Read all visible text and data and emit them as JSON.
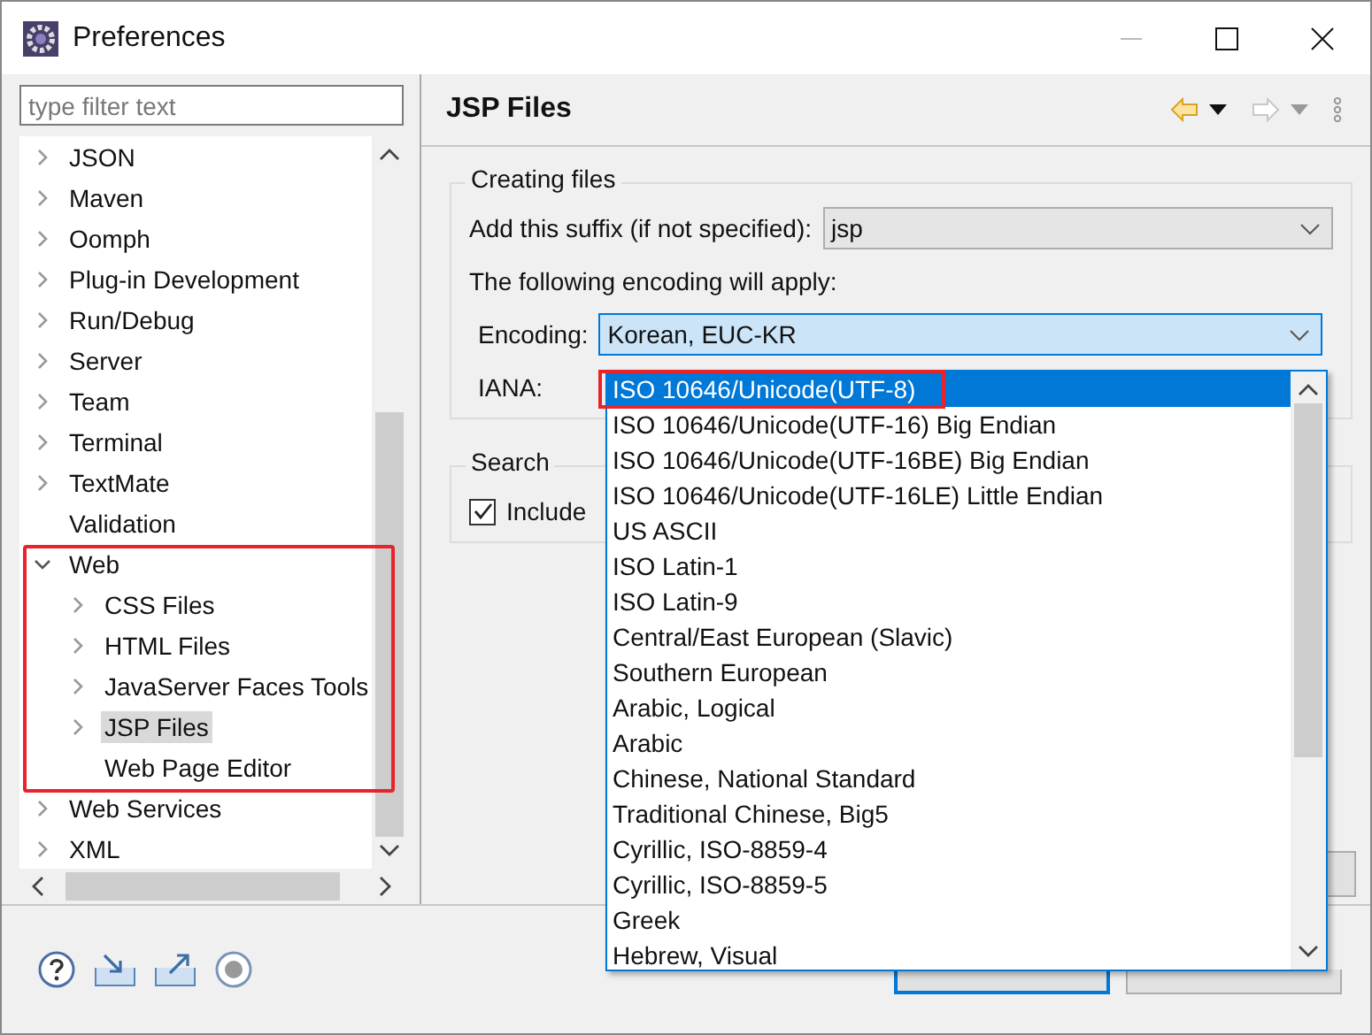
{
  "window": {
    "title": "Preferences"
  },
  "filter": {
    "placeholder": "type filter text"
  },
  "tree": [
    {
      "label": "JSON",
      "expanded": false,
      "selected": false
    },
    {
      "label": "Maven",
      "expanded": false,
      "selected": false
    },
    {
      "label": "Oomph",
      "expanded": false,
      "selected": false
    },
    {
      "label": "Plug-in Development",
      "expanded": false,
      "selected": false
    },
    {
      "label": "Run/Debug",
      "expanded": false,
      "selected": false
    },
    {
      "label": "Server",
      "expanded": false,
      "selected": false
    },
    {
      "label": "Team",
      "expanded": false,
      "selected": false
    },
    {
      "label": "Terminal",
      "expanded": false,
      "selected": false
    },
    {
      "label": "TextMate",
      "expanded": false,
      "selected": false
    },
    {
      "label": "Validation",
      "leaf": true,
      "selected": false
    },
    {
      "label": "Web",
      "expanded": true,
      "selected": false,
      "children": [
        {
          "label": "CSS Files",
          "expanded": false,
          "selected": false
        },
        {
          "label": "HTML Files",
          "expanded": false,
          "selected": false
        },
        {
          "label": "JavaServer Faces Tools",
          "expanded": false,
          "selected": false
        },
        {
          "label": "JSP Files",
          "expanded": false,
          "selected": true
        },
        {
          "label": "Web Page Editor",
          "leaf": true,
          "selected": false
        }
      ]
    },
    {
      "label": "Web Services",
      "expanded": false,
      "selected": false
    },
    {
      "label": "XML",
      "expanded": false,
      "selected": false
    }
  ],
  "page": {
    "title": "JSP Files",
    "creating_group": {
      "title": "Creating files",
      "suffix_label": "Add this suffix (if not specified):",
      "suffix_value": "jsp",
      "encoding_note": "The following encoding will apply:",
      "encoding_label": "Encoding:",
      "encoding_value": "Korean, EUC-KR",
      "iana_label": "IANA:"
    },
    "search_group": {
      "title": "Search",
      "checkbox_label": "Include",
      "checked": true
    }
  },
  "encoding_list": [
    {
      "label": "ISO 10646/Unicode(UTF-8)",
      "selected": true
    },
    {
      "label": "ISO 10646/Unicode(UTF-16) Big Endian",
      "selected": false
    },
    {
      "label": "ISO 10646/Unicode(UTF-16BE) Big Endian",
      "selected": false
    },
    {
      "label": "ISO 10646/Unicode(UTF-16LE) Little Endian",
      "selected": false
    },
    {
      "label": "US ASCII",
      "selected": false
    },
    {
      "label": "ISO Latin-1",
      "selected": false
    },
    {
      "label": "ISO Latin-9",
      "selected": false
    },
    {
      "label": "Central/East European (Slavic)",
      "selected": false
    },
    {
      "label": "Southern European",
      "selected": false
    },
    {
      "label": "Arabic, Logical",
      "selected": false
    },
    {
      "label": "Arabic",
      "selected": false
    },
    {
      "label": "Chinese, National Standard",
      "selected": false
    },
    {
      "label": "Traditional Chinese, Big5",
      "selected": false
    },
    {
      "label": "Cyrillic, ISO-8859-4",
      "selected": false
    },
    {
      "label": "Cyrillic, ISO-8859-5",
      "selected": false
    },
    {
      "label": "Greek",
      "selected": false
    },
    {
      "label": "Hebrew, Visual",
      "selected": false
    }
  ]
}
